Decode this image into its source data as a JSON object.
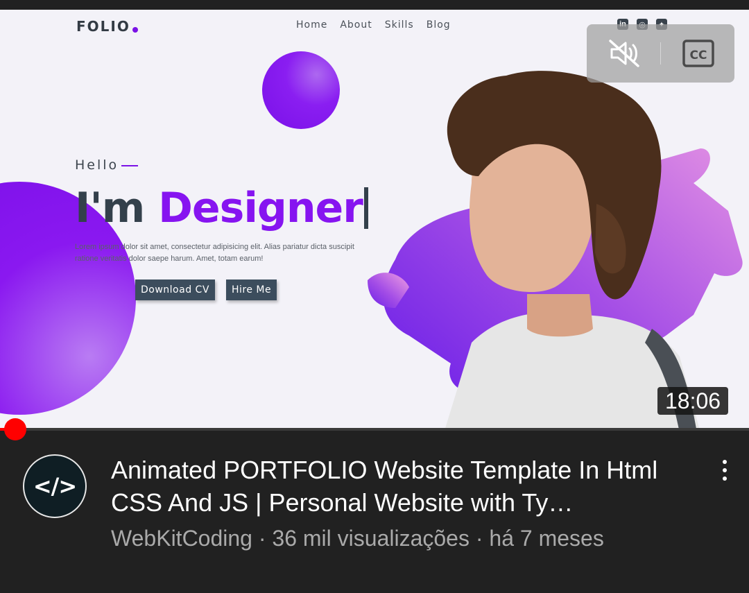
{
  "thumbnail": {
    "site_logo": "FOLIO",
    "nav": [
      "Home",
      "About",
      "Skills",
      "Blog"
    ],
    "social_icons": [
      {
        "name": "linkedin-icon",
        "glyph": "in"
      },
      {
        "name": "instagram-icon",
        "glyph": "◎"
      },
      {
        "name": "twitter-icon",
        "glyph": "✦"
      }
    ],
    "hello": "Hello",
    "headline_prefix": "I'm",
    "headline_accent": "Designer",
    "lorem": "Lorem ipsum dolor sit amet, consectetur adipisicing elit. Alias pariatur dicta suscipit ratione veritatis dolor saepe harum. Amet, totam earum!",
    "buttons": {
      "download": "Download CV",
      "hire": "Hire Me"
    },
    "accent_color": "#8614f0"
  },
  "player": {
    "duration": "18:06",
    "progress_fraction": 0.02,
    "controls": {
      "mute_icon": "volume-off-icon",
      "captions_icon": "closed-captions-icon",
      "captions_label": "CC"
    }
  },
  "video": {
    "channel_avatar": "</>",
    "title": "Animated PORTFOLIO Website Template In Html CSS And JS | Personal Website with Ty…",
    "meta": "WebKitCoding · 36 mil visualizações · há 7 meses",
    "more_icon": "more-vert-icon"
  }
}
